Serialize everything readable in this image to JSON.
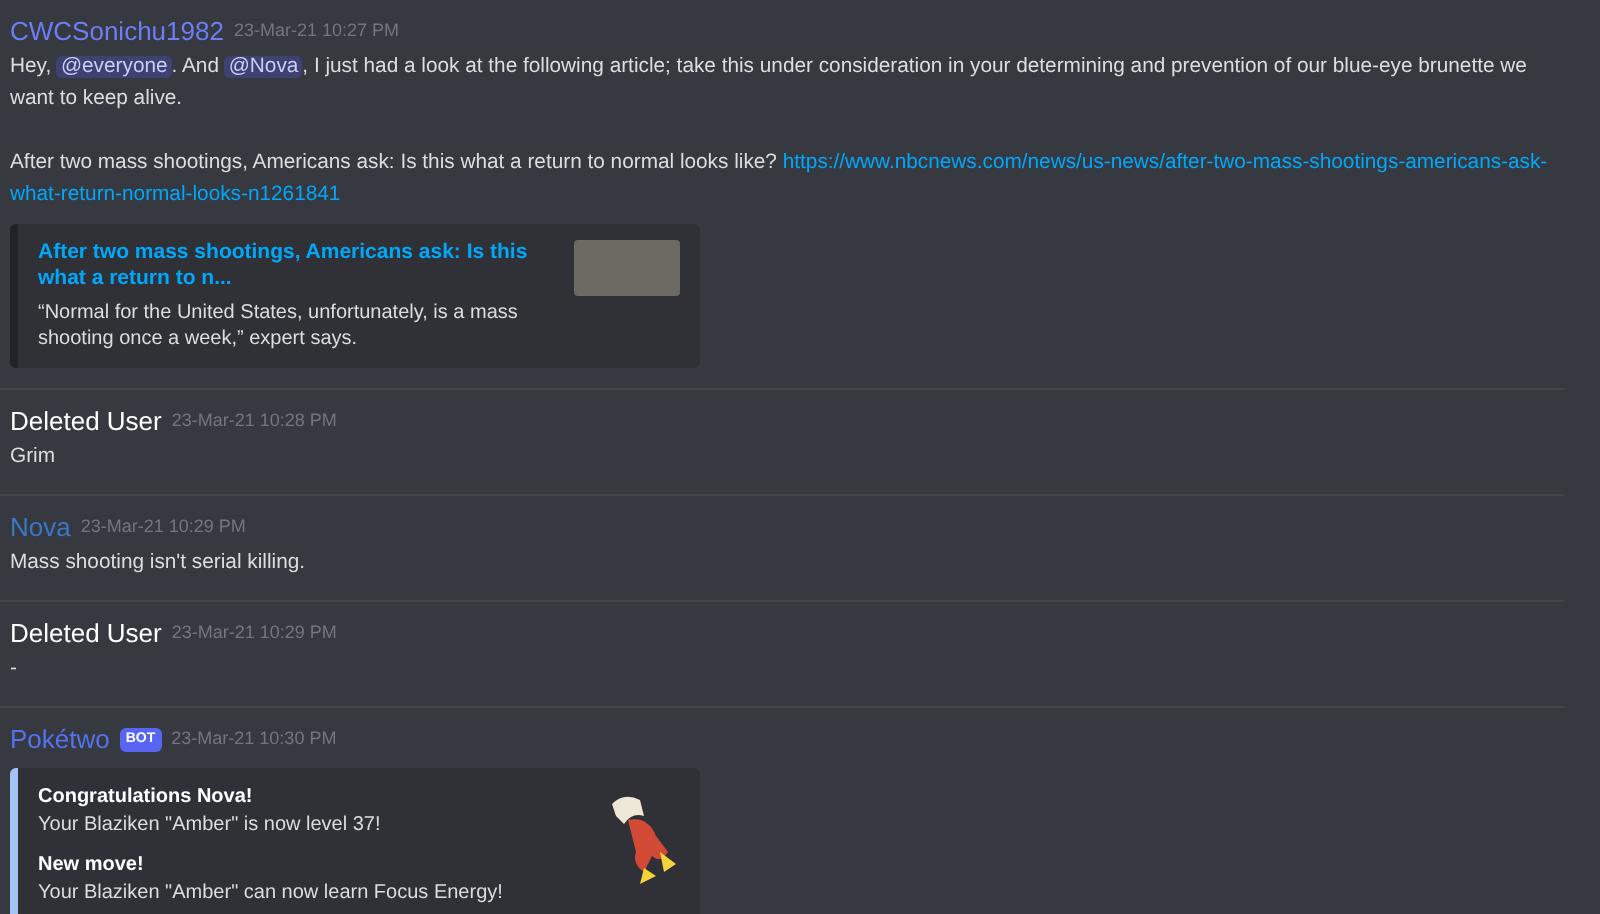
{
  "messages": [
    {
      "author": "CWCSonichu1982",
      "color": "#6b7ef5",
      "time": "23-Mar-21 10:27 PM",
      "paragraphs": [
        [
          {
            "kind": "text",
            "text": "Hey, "
          },
          {
            "kind": "mention",
            "text": "@everyone"
          },
          {
            "kind": "text",
            "text": ".  And "
          },
          {
            "kind": "mention",
            "text": "@Nova"
          },
          {
            "kind": "text",
            "text": ", I just had a look at the following article; take this under consideration in your determining and prevention of our blue-eye brunette we want to keep alive."
          }
        ],
        [
          {
            "kind": "text",
            "text": "After two mass shootings, Americans ask: Is this what a return to normal looks like? "
          },
          {
            "kind": "link",
            "text": "https://www.nbcnews.com/news/us-news/after-two-mass-shootings-americans-ask-"
          },
          {
            "kind": "break"
          },
          {
            "kind": "link",
            "text": "what-return-normal-looks-n1261841"
          }
        ]
      ],
      "embed": {
        "kind": "link",
        "title": "After two mass shootings, Americans ask: Is this what a return to n...",
        "description": "“Normal for the United States, unfortunately, is a mass shooting once a week,” expert says."
      }
    },
    {
      "author": "Deleted User",
      "color": "#ffffff",
      "time": "23-Mar-21 10:28 PM",
      "paragraphs": [
        [
          {
            "kind": "text",
            "text": "Grim"
          }
        ]
      ]
    },
    {
      "author": "Nova",
      "color": "#3b78c4",
      "time": "23-Mar-21 10:29 PM",
      "paragraphs": [
        [
          {
            "kind": "text",
            "text": "Mass shooting isn't serial killing."
          }
        ]
      ]
    },
    {
      "author": "Deleted User",
      "color": "#ffffff",
      "time": "23-Mar-21 10:29 PM",
      "paragraphs": [
        [
          {
            "kind": "text",
            "text": "-"
          }
        ]
      ]
    },
    {
      "author": "Pokétwo",
      "color": "#5572f0",
      "badge": "BOT",
      "time": "23-Mar-21 10:30 PM",
      "embed": {
        "kind": "fields",
        "fields": [
          {
            "name": "Congratulations Nova!",
            "value": "Your Blaziken \"Amber\" is now level 37!"
          },
          {
            "name": "New move!",
            "value": "Your Blaziken \"Amber\" can now learn Focus Energy!"
          }
        ]
      }
    }
  ]
}
